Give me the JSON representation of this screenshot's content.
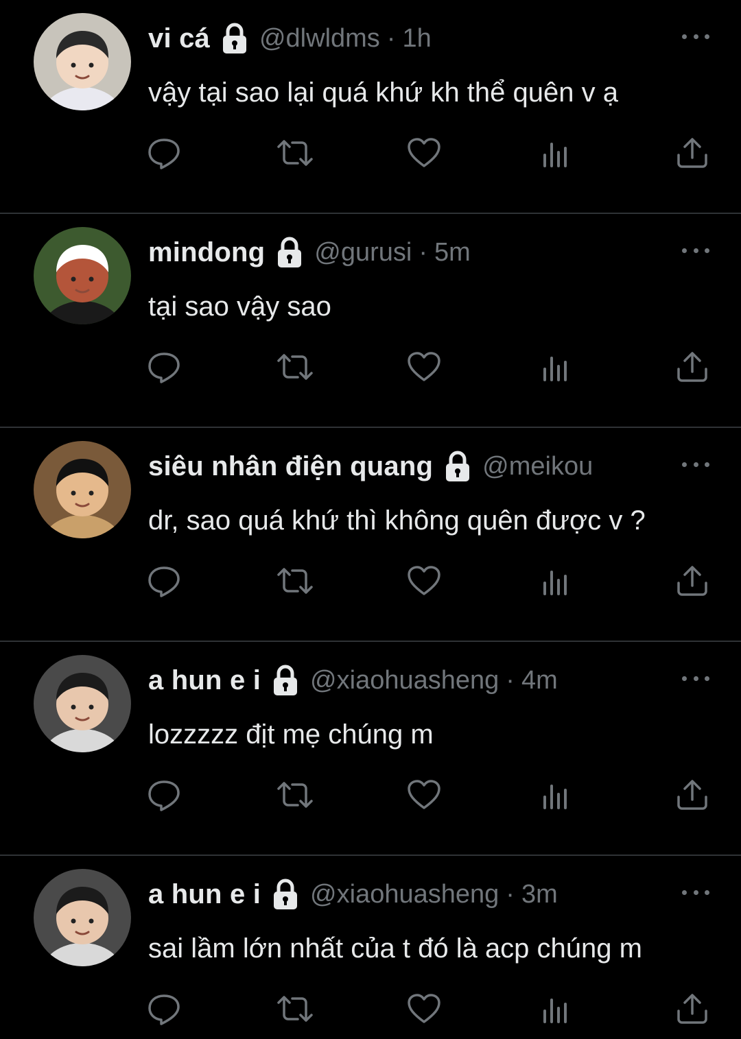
{
  "colors": {
    "background": "#000000",
    "primary_text": "#e7e9ea",
    "secondary_text": "#71767b",
    "divider": "#2f3336"
  },
  "icons": {
    "lock": "lock-icon",
    "more": "more-icon",
    "reply": "reply-icon",
    "retweet": "retweet-icon",
    "like": "heart-icon",
    "views": "views-icon",
    "share": "share-icon"
  },
  "tweets": [
    {
      "name": "vi cá",
      "handle": "@dlwldms",
      "separator": "·",
      "time": "1h",
      "text": "vậy tại sao lại quá khứ kh thể quên v ạ",
      "avatar_colors": [
        "#c8c4bb",
        "#f1d7c2",
        "#2a2a2a",
        "#e9e9f0"
      ]
    },
    {
      "name": "mindong",
      "handle": "@gurusi",
      "separator": "·",
      "time": "5m",
      "text": "tại sao vậy sao",
      "avatar_colors": [
        "#3d5a2f",
        "#b4553a",
        "#ffffff",
        "#1a1a1a"
      ]
    },
    {
      "name": "siêu nhân điện quang",
      "handle": "@meikou",
      "separator": "",
      "time": "",
      "text": "dr, sao quá khứ thì không quên được v ?",
      "avatar_colors": [
        "#7a5a3a",
        "#e5b98c",
        "#111111",
        "#c9a06a"
      ]
    },
    {
      "name": "a hun e i",
      "handle": "@xiaohuasheng",
      "separator": "·",
      "time": "4m",
      "text": "lozzzzz địt mẹ chúng m",
      "avatar_colors": [
        "#4a4a4a",
        "#e8c7ad",
        "#1b1b1b",
        "#d9d9d9"
      ]
    },
    {
      "name": "a hun e i",
      "handle": "@xiaohuasheng",
      "separator": "·",
      "time": "3m",
      "text": "sai lầm lớn nhất của t đó là acp chúng m",
      "avatar_colors": [
        "#4a4a4a",
        "#e8c7ad",
        "#1b1b1b",
        "#d9d9d9"
      ]
    }
  ]
}
